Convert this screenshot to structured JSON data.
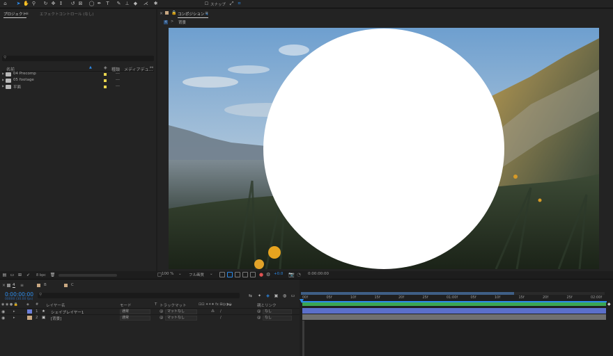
{
  "toolbar": {
    "snap_label": "スナップ",
    "tools": [
      "selection-tool-icon",
      "hand-tool-icon",
      "zoom-tool-icon",
      "orbit-tool-icon",
      "pan-tool-icon",
      "dolly-tool-icon",
      "rotation-tool-icon",
      "anchor-tool-icon",
      "ellipse-tool-icon",
      "pen-tool-icon",
      "type-tool-icon",
      "brush-tool-icon",
      "stamp-tool-icon",
      "eraser-tool-icon",
      "roto-tool-icon",
      "puppet-tool-icon"
    ]
  },
  "project_panel": {
    "tab_project": "プロジェクト",
    "tab_effects": "エフェクトコントロール (なし)",
    "col_name": "名前",
    "col_type": "種類",
    "col_media": "メディアデュ...",
    "items": [
      {
        "name": "04 Precomp",
        "type": "---"
      },
      {
        "name": "05 footage",
        "type": "---"
      },
      {
        "name": "平面",
        "type": "---"
      }
    ],
    "bpc": "8 bpc"
  },
  "comp_panel": {
    "tab_label": "コンポジション",
    "tab_name": "4",
    "breadcrumb": "背景",
    "zoom": "100 %",
    "quality": "フル画質",
    "exposure": "+0.0",
    "timecode": "0:00:00:00"
  },
  "timeline": {
    "tabs": [
      "4",
      "B",
      "C"
    ],
    "tab_colors": [
      "#8a8a8a",
      "#c9a882",
      "#c9a882"
    ],
    "timecode": "0:00:00:00",
    "framecode": "00000 (30.00 fps)",
    "col_layer_name": "レイヤー名",
    "col_mode": "モード",
    "col_t": "T",
    "col_track": "トラックマット",
    "col_parent": "親とリンク",
    "layers": [
      {
        "num": "1",
        "type": "★",
        "name": "シェイプレイヤー1",
        "color": "#6c7fd8",
        "mode": "通常",
        "track": "マットなし",
        "parent": "なし"
      },
      {
        "num": "2",
        "type": "▣",
        "name": "[背景]",
        "color": "#c9a882",
        "mode": "通常",
        "track": "マットなし",
        "parent": "なし"
      }
    ],
    "ticks": [
      "00f",
      "05f",
      "10f",
      "15f",
      "20f",
      "25f",
      "01:00f",
      "05f",
      "10f",
      "15f",
      "20f",
      "25f",
      "02:00f"
    ],
    "bar_colors": [
      "#5b6fc9",
      "#707070"
    ]
  }
}
